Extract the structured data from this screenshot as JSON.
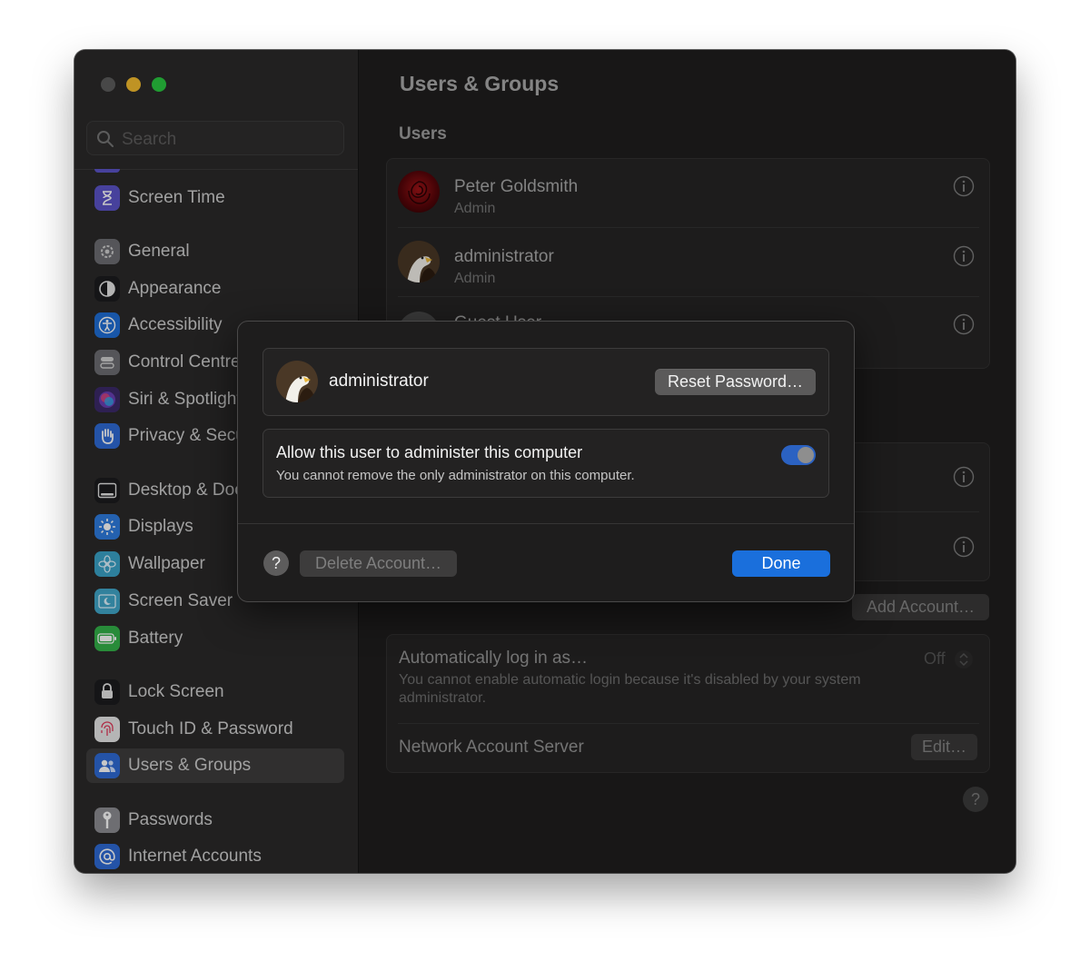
{
  "window": {
    "traffic_lights": {
      "close": "#5d5d5d",
      "minimize": "#f5bd2f",
      "maximize": "#29c840"
    }
  },
  "sidebar": {
    "search_placeholder": "Search",
    "items": [
      {
        "label": "Screen Time",
        "icon": "hourglass-icon",
        "color": "#5b54c8"
      },
      {
        "label": "General",
        "icon": "gear-icon",
        "color": "#6e6e73"
      },
      {
        "label": "Appearance",
        "icon": "appearance-icon",
        "color": "#1c1c1e"
      },
      {
        "label": "Accessibility",
        "icon": "accessibility-icon",
        "color": "#1f6fd8"
      },
      {
        "label": "Control Centre",
        "icon": "control-centre-icon",
        "color": "#6e6e73"
      },
      {
        "label": "Siri & Spotlight",
        "icon": "siri-icon",
        "color": "#3b2a6a"
      },
      {
        "label": "Privacy & Security",
        "icon": "hand-icon",
        "color": "#2f6bd6"
      },
      {
        "label": "Desktop & Dock",
        "icon": "dock-icon",
        "color": "#1c1c1e"
      },
      {
        "label": "Displays",
        "icon": "sun-icon",
        "color": "#2f7de1"
      },
      {
        "label": "Wallpaper",
        "icon": "flower-icon",
        "color": "#3aa3c8"
      },
      {
        "label": "Screen Saver",
        "icon": "screen-saver-icon",
        "color": "#41a7c9"
      },
      {
        "label": "Battery",
        "icon": "battery-icon",
        "color": "#34b24a"
      },
      {
        "label": "Lock Screen",
        "icon": "lock-icon",
        "color": "#1c1c1e"
      },
      {
        "label": "Touch ID & Password",
        "icon": "fingerprint-icon",
        "color": "#e8e8e8"
      },
      {
        "label": "Users & Groups",
        "icon": "users-icon",
        "color": "#2f6bd6"
      },
      {
        "label": "Passwords",
        "icon": "key-icon",
        "color": "#8e8e93"
      },
      {
        "label": "Internet Accounts",
        "icon": "at-icon",
        "color": "#2f6bd6"
      }
    ]
  },
  "content": {
    "title": "Users & Groups",
    "users_section": "Users",
    "users": [
      {
        "name": "Peter Goldsmith",
        "role": "Admin",
        "avatar": "rose-avatar"
      },
      {
        "name": "administrator",
        "role": "Admin",
        "avatar": "eagle-avatar"
      },
      {
        "name": "Guest User",
        "role": "",
        "avatar": "guest-avatar"
      }
    ],
    "add_account": "Add Account…",
    "auto_login": {
      "label": "Automatically log in as…",
      "value": "Off",
      "note": "You cannot enable automatic login because it's disabled by your system administrator."
    },
    "network_server": {
      "label": "Network Account Server",
      "button": "Edit…"
    },
    "help": "?"
  },
  "dialog": {
    "user_name": "administrator",
    "reset_password": "Reset Password…",
    "allow_admin": {
      "label": "Allow this user to administer this computer",
      "note": "You cannot remove the only administrator on this computer.",
      "enabled": true
    },
    "help": "?",
    "delete_account": "Delete Account…",
    "done": "Done"
  }
}
